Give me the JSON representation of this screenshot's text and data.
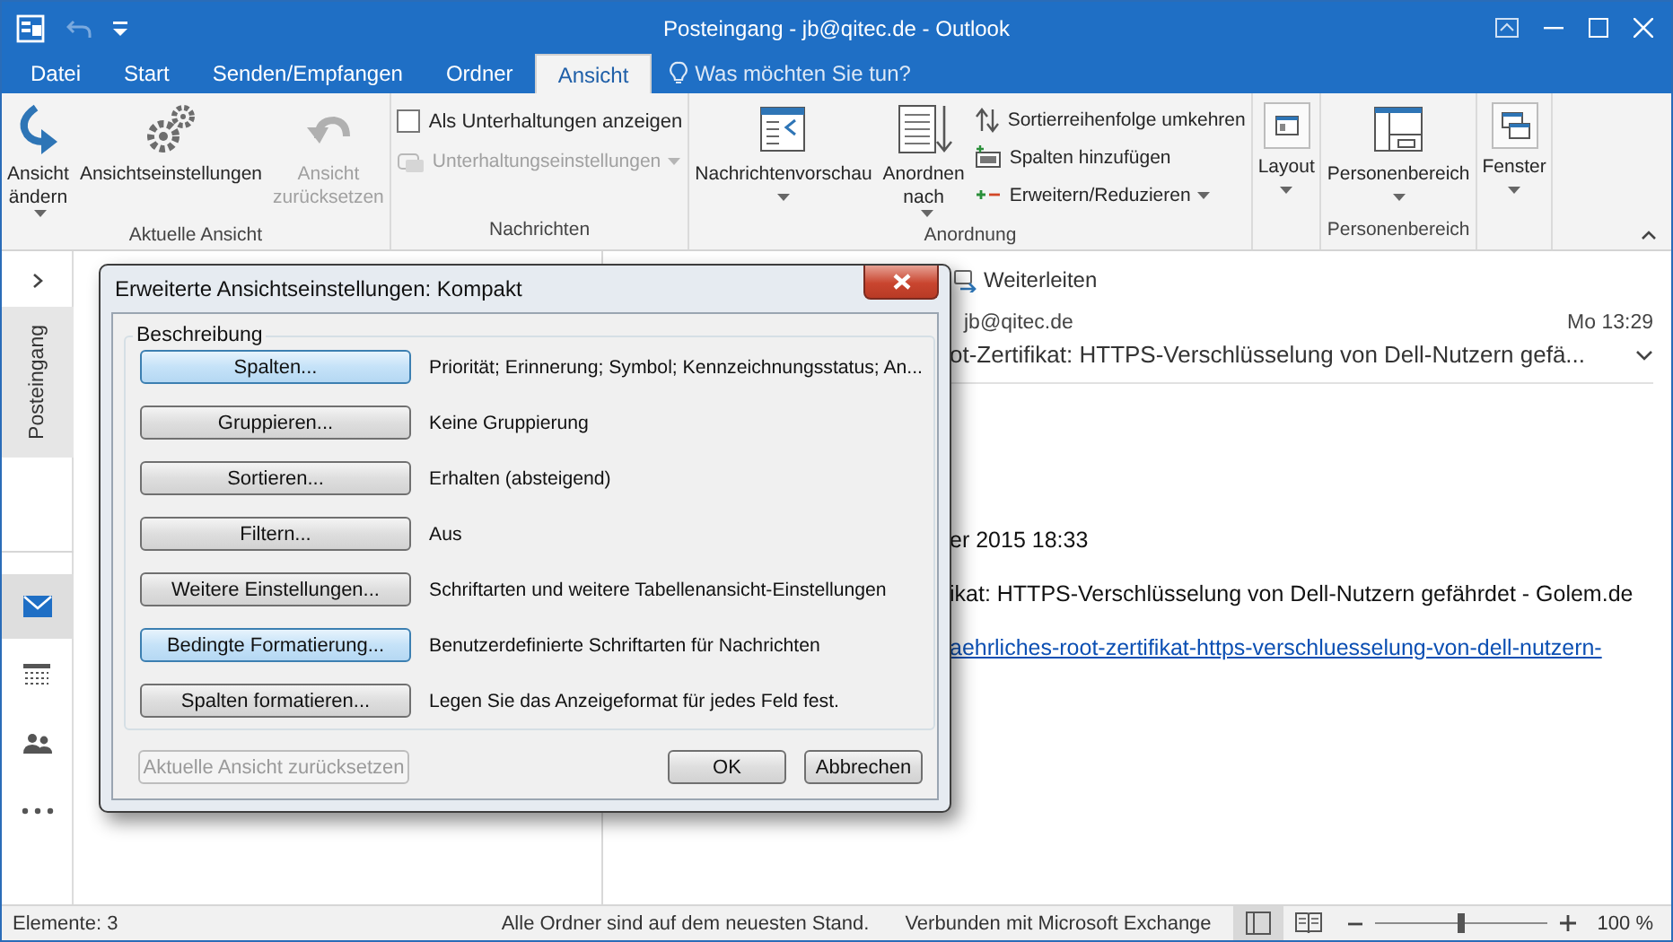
{
  "window": {
    "title": "Posteingang - jb@qitec.de - Outlook"
  },
  "tabs": [
    {
      "label": "Datei",
      "selected": false
    },
    {
      "label": "Start",
      "selected": false
    },
    {
      "label": "Senden/Empfangen",
      "selected": false
    },
    {
      "label": "Ordner",
      "selected": false
    },
    {
      "label": "Ansicht",
      "selected": true
    }
  ],
  "tell_me": {
    "placeholder": "Was möchten Sie tun?"
  },
  "ribbon": {
    "groups": [
      {
        "label": "Aktuelle Ansicht",
        "items": [
          {
            "kind": "large",
            "lines": [
              "Ansicht",
              "ändern"
            ],
            "dropdown": true,
            "disabled": false
          },
          {
            "kind": "large",
            "lines": [
              "Ansichtseinstellungen"
            ],
            "dropdown": false,
            "disabled": false
          },
          {
            "kind": "large",
            "lines": [
              "Ansicht",
              "zurücksetzen"
            ],
            "dropdown": false,
            "disabled": true
          }
        ]
      },
      {
        "label": "Nachrichten",
        "items": [
          {
            "kind": "checkbox",
            "label": "Als Unterhaltungen anzeigen",
            "checked": false
          },
          {
            "kind": "small",
            "label": "Unterhaltungseinstellungen",
            "dropdown": true,
            "disabled": true
          }
        ]
      },
      {
        "label": "Anordnung",
        "items": [
          {
            "kind": "large",
            "lines": [
              "Nachrichtenvorschau"
            ],
            "dropdown": true,
            "disabled": false
          },
          {
            "kind": "large",
            "lines": [
              "Anordnen",
              "nach"
            ],
            "dropdown": true,
            "disabled": false
          },
          {
            "kind": "small",
            "label": "Sortierreihenfolge umkehren",
            "dropdown": false,
            "disabled": false
          },
          {
            "kind": "small",
            "label": "Spalten hinzufügen",
            "dropdown": false,
            "disabled": false
          },
          {
            "kind": "small",
            "label": "Erweitern/Reduzieren",
            "dropdown": true,
            "disabled": false
          }
        ]
      },
      {
        "items": [
          {
            "kind": "large",
            "lines": [
              "Layout"
            ],
            "dropdown": true,
            "disabled": false
          }
        ]
      },
      {
        "label": "Personenbereich",
        "items": [
          {
            "kind": "large",
            "lines": [
              "Personenbereich"
            ],
            "dropdown": true,
            "disabled": false
          }
        ]
      },
      {
        "items": [
          {
            "kind": "large",
            "lines": [
              "Fenster"
            ],
            "dropdown": true,
            "disabled": false
          }
        ]
      }
    ]
  },
  "navigation": {
    "folder": "Posteingang",
    "modules": [
      {
        "selected": true
      },
      {
        "selected": false
      },
      {
        "selected": false
      },
      {
        "selected": false
      }
    ]
  },
  "reading_pane": {
    "actions": [
      {
        "label": "Weiterleiten"
      }
    ],
    "sender": "jb@qitec.de",
    "time": "Mo 13:29",
    "subject": "ot-Zertifikat: HTTPS-Verschlüsselung von Dell-Nutzern gefä...",
    "body": [
      {
        "kind": "text",
        "text": "er 2015 18:33"
      },
      {
        "kind": "text",
        "text": "ikat: HTTPS-Verschlüsselung von Dell-Nutzern gefährdet - Golem.de"
      },
      {
        "kind": "link",
        "text": "aehrliches-root-zertifikat-https-verschluesselung-von-dell-nutzern-"
      }
    ]
  },
  "dialog": {
    "title": "Erweiterte Ansichtseinstellungen: Kompakt",
    "group": "Beschreibung",
    "rows": [
      {
        "button": "Spalten...",
        "highlighted": true,
        "description": "Priorität; Erinnerung; Symbol; Kennzeichnungsstatus; An..."
      },
      {
        "button": "Gruppieren...",
        "highlighted": false,
        "description": "Keine Gruppierung"
      },
      {
        "button": "Sortieren...",
        "highlighted": false,
        "description": "Erhalten (absteigend)"
      },
      {
        "button": "Filtern...",
        "highlighted": false,
        "description": "Aus"
      },
      {
        "button": "Weitere Einstellungen...",
        "highlighted": false,
        "description": "Schriftarten und weitere Tabellenansicht-Einstellungen"
      },
      {
        "button": "Bedingte Formatierung...",
        "highlighted": true,
        "description": "Benutzerdefinierte Schriftarten für Nachrichten"
      },
      {
        "button": "Spalten formatieren...",
        "highlighted": false,
        "description": "Legen Sie das Anzeigeformat für jedes Feld fest."
      }
    ],
    "footer": [
      {
        "label": "Aktuelle Ansicht zurücksetzen",
        "disabled": true
      },
      {
        "label": "OK",
        "disabled": false
      },
      {
        "label": "Abbrechen",
        "disabled": false
      }
    ]
  },
  "status_bar": {
    "items": "Elemente: 3",
    "sync": "Alle Ordner sind auf dem neuesten Stand.",
    "connection": "Verbunden mit Microsoft Exchange",
    "views": [
      {
        "selected": true
      },
      {
        "selected": false
      }
    ],
    "zoom": {
      "level": 0.5,
      "reading": "100 %"
    }
  }
}
